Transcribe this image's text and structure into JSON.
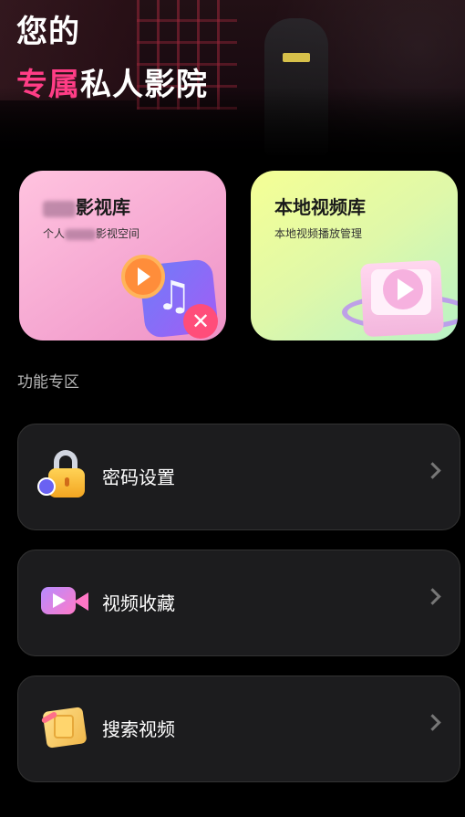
{
  "header": {
    "line1": "您的",
    "line2_accent": "专属",
    "line2_rest": "私人影院"
  },
  "cards": {
    "private_library": {
      "title_suffix": "影视库",
      "subtitle_prefix": "个人",
      "subtitle_suffix": "影视空间",
      "color": "#f5a6d1"
    },
    "local_library": {
      "title": "本地视频库",
      "subtitle": "本地视频播放管理",
      "color": "#e6fa9f"
    }
  },
  "section": {
    "title": "功能专区"
  },
  "menu": [
    {
      "label": "密码设置",
      "icon": "lock-icon"
    },
    {
      "label": "视频收藏",
      "icon": "video-camera-icon"
    },
    {
      "label": "搜索视频",
      "icon": "search-book-icon"
    }
  ],
  "colors": {
    "accent": "#ff3d86",
    "background": "#000000",
    "row_bg": "#1c1c1e"
  }
}
